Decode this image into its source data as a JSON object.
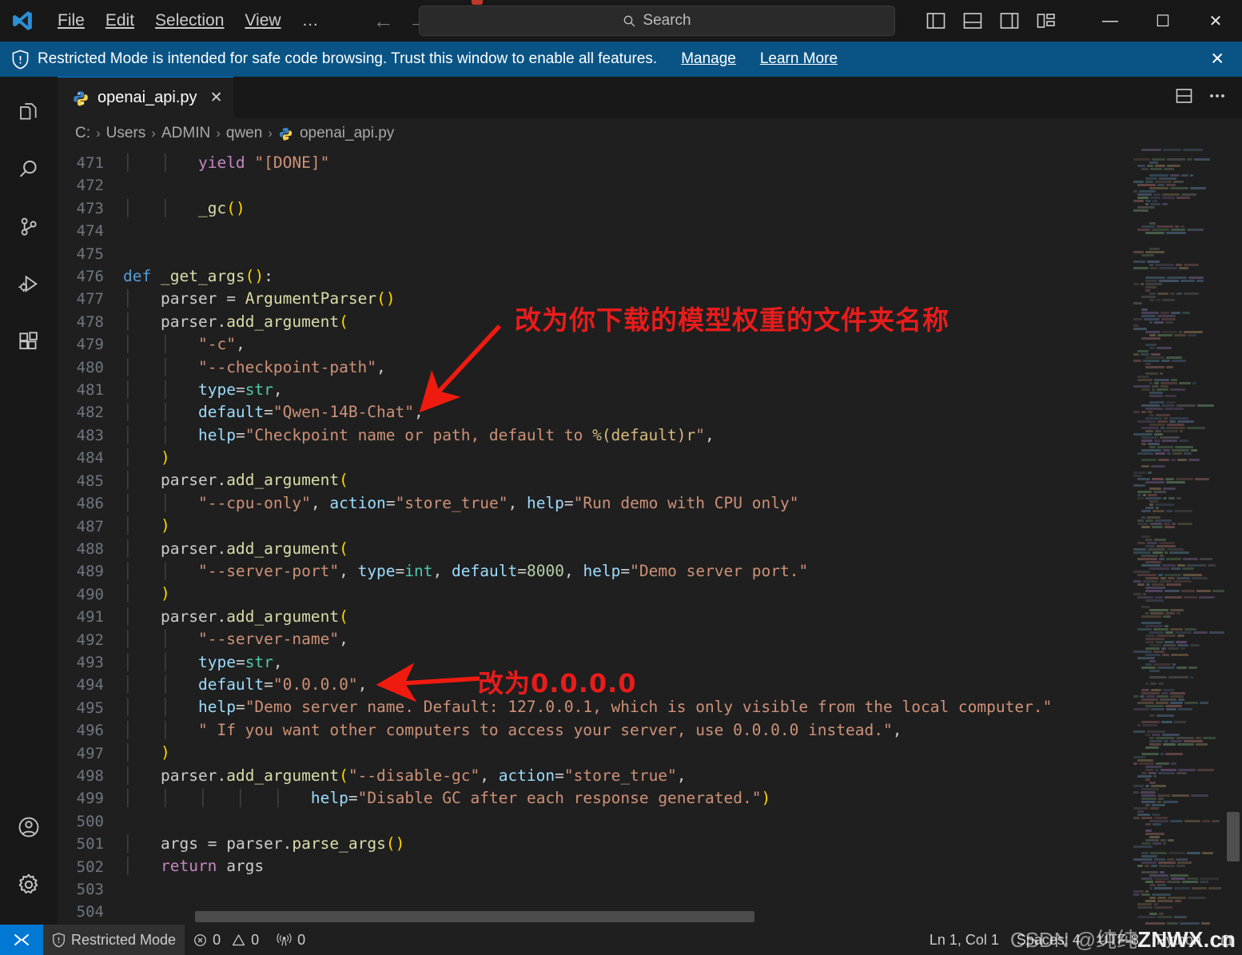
{
  "titlebar": {
    "logo_icon": "vscode-logo-icon",
    "menu": [
      {
        "label": "File",
        "accel": "F"
      },
      {
        "label": "Edit",
        "accel": "E"
      },
      {
        "label": "Selection",
        "accel": "S"
      },
      {
        "label": "View",
        "accel": "V"
      },
      {
        "label": "…",
        "accel": ""
      }
    ],
    "nav_back_icon": "arrow-left-icon",
    "nav_forward_icon": "arrow-right-icon",
    "search_placeholder": "Search",
    "search_value": "",
    "layout_icons": [
      "toggle-primary-sidebar-icon",
      "toggle-panel-icon",
      "toggle-secondary-sidebar-icon",
      "customize-layout-icon"
    ],
    "window_controls": {
      "minimize": "—",
      "maximize": "☐",
      "close": "✕"
    }
  },
  "banner": {
    "shield_icon": "shield-icon",
    "message": "Restricted Mode is intended for safe code browsing. Trust this window to enable all features.",
    "manage_label": "Manage",
    "learn_more_label": "Learn More",
    "close_icon": "close-icon",
    "bg_color": "#0a5485"
  },
  "activitybar": {
    "items": [
      {
        "name": "explorer",
        "icon": "files-icon"
      },
      {
        "name": "search",
        "icon": "search-icon"
      },
      {
        "name": "source-control",
        "icon": "source-control-icon"
      },
      {
        "name": "run-and-debug",
        "icon": "run-debug-icon"
      },
      {
        "name": "extensions",
        "icon": "extensions-icon"
      }
    ],
    "bottom_items": [
      {
        "name": "accounts",
        "icon": "account-icon"
      },
      {
        "name": "manage",
        "icon": "gear-icon"
      }
    ]
  },
  "tabs": {
    "items": [
      {
        "label": "openai_api.py",
        "icon": "python-file-icon",
        "active": true,
        "close_icon": "close-icon"
      }
    ],
    "actions": [
      {
        "name": "split-editor",
        "icon": "split-editor-icon"
      },
      {
        "name": "more-actions",
        "icon": "ellipsis-icon"
      }
    ]
  },
  "breadcrumb": {
    "items": [
      "C:",
      "Users",
      "ADMIN",
      "qwen",
      "openai_api.py"
    ],
    "separator": "›",
    "file_icon": "python-file-icon"
  },
  "editor": {
    "first_line": 471,
    "lines": [
      {
        "n": 471,
        "indent": 2,
        "text": "yield \"[DONE]\""
      },
      {
        "n": 472,
        "indent": 0,
        "text": ""
      },
      {
        "n": 473,
        "indent": 2,
        "text": "_gc()"
      },
      {
        "n": 474,
        "indent": 0,
        "text": ""
      },
      {
        "n": 475,
        "indent": 0,
        "text": ""
      },
      {
        "n": 476,
        "indent": 0,
        "text": "def _get_args():"
      },
      {
        "n": 477,
        "indent": 1,
        "text": "parser = ArgumentParser()"
      },
      {
        "n": 478,
        "indent": 1,
        "text": "parser.add_argument("
      },
      {
        "n": 479,
        "indent": 2,
        "text": "\"-c\","
      },
      {
        "n": 480,
        "indent": 2,
        "text": "\"--checkpoint-path\","
      },
      {
        "n": 481,
        "indent": 2,
        "text": "type=str,"
      },
      {
        "n": 482,
        "indent": 2,
        "text": "default=\"Qwen-14B-Chat\","
      },
      {
        "n": 483,
        "indent": 2,
        "text": "help=\"Checkpoint name or path, default to %(default)r\","
      },
      {
        "n": 484,
        "indent": 1,
        "text": ")"
      },
      {
        "n": 485,
        "indent": 1,
        "text": "parser.add_argument("
      },
      {
        "n": 486,
        "indent": 2,
        "text": "\"--cpu-only\", action=\"store_true\", help=\"Run demo with CPU only\""
      },
      {
        "n": 487,
        "indent": 1,
        "text": ")"
      },
      {
        "n": 488,
        "indent": 1,
        "text": "parser.add_argument("
      },
      {
        "n": 489,
        "indent": 2,
        "text": "\"--server-port\", type=int, default=8000, help=\"Demo server port.\""
      },
      {
        "n": 490,
        "indent": 1,
        "text": ")"
      },
      {
        "n": 491,
        "indent": 1,
        "text": "parser.add_argument("
      },
      {
        "n": 492,
        "indent": 2,
        "text": "\"--server-name\","
      },
      {
        "n": 493,
        "indent": 2,
        "text": "type=str,"
      },
      {
        "n": 494,
        "indent": 2,
        "text": "default=\"0.0.0.0\","
      },
      {
        "n": 495,
        "indent": 2,
        "text": "help=\"Demo server name. Default: 127.0.0.1, which is only visible from the local computer.\""
      },
      {
        "n": 496,
        "indent": 2,
        "text": "\" If you want other computers to access your server, use 0.0.0.0 instead.\","
      },
      {
        "n": 497,
        "indent": 1,
        "text": ")"
      },
      {
        "n": 498,
        "indent": 1,
        "text": "parser.add_argument(\"--disable-gc\", action=\"store_true\","
      },
      {
        "n": 499,
        "indent": 5,
        "text": "help=\"Disable GC after each response generated.\")"
      },
      {
        "n": 500,
        "indent": 0,
        "text": ""
      },
      {
        "n": 501,
        "indent": 1,
        "text": "args = parser.parse_args()"
      },
      {
        "n": 502,
        "indent": 1,
        "text": "return args"
      },
      {
        "n": 503,
        "indent": 0,
        "text": ""
      },
      {
        "n": 504,
        "indent": 0,
        "text": ""
      }
    ]
  },
  "annotations": [
    {
      "name": "annotation-checkpoint-path",
      "text": "改为你下载的模型权重的文件夹名称",
      "color": "#e81c1c"
    },
    {
      "name": "annotation-server-name",
      "text": "改为0.0.0.0",
      "color": "#e81c1c"
    }
  ],
  "statusbar": {
    "remote_icon": "remote-window-icon",
    "restricted_mode": {
      "icon": "shield-icon",
      "label": "Restricted Mode"
    },
    "problems": {
      "errors_icon": "error-icon",
      "errors": "0",
      "warnings_icon": "warning-icon",
      "warnings": "0"
    },
    "ports": {
      "icon": "radio-tower-icon",
      "count": "0"
    },
    "cursor_position": "Ln 1, Col 1",
    "indentation": "Spaces: 4",
    "encoding": "UTF-8",
    "language": "Python",
    "bell_icon": "bell-icon"
  },
  "watermark": {
    "prefix": "CSDN @纯纯",
    "brand": "ZNWX.cn",
    "suffix": "Python"
  }
}
